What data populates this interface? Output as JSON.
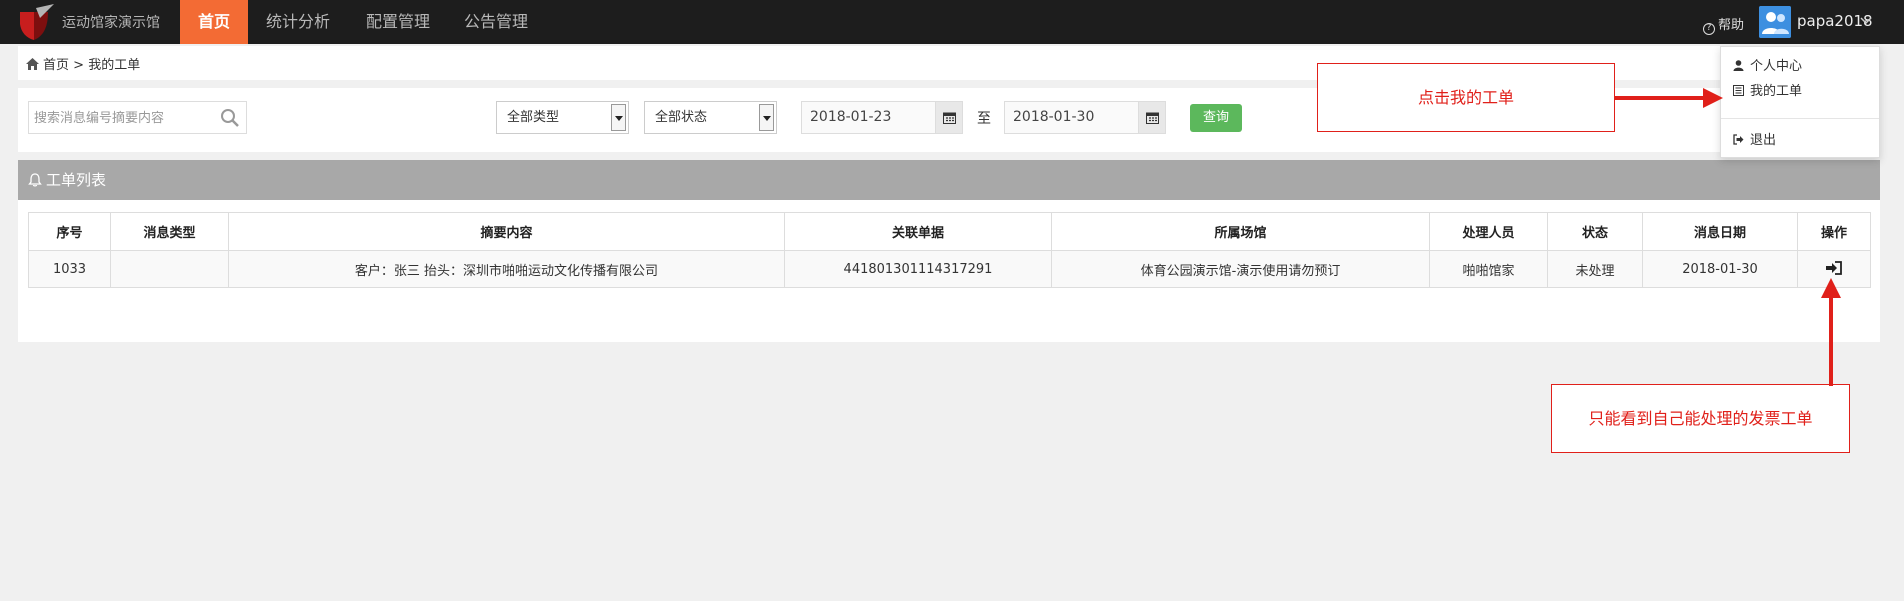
{
  "app": {
    "title": "运动馆家演示馆"
  },
  "nav": {
    "items": [
      {
        "label": "首页",
        "active": true
      },
      {
        "label": "统计分析",
        "active": false
      },
      {
        "label": "配置管理",
        "active": false
      },
      {
        "label": "公告管理",
        "active": false
      }
    ],
    "help_label": "帮助",
    "username": "papa2018"
  },
  "breadcrumb": {
    "home": "首页",
    "separator": ">",
    "current": "我的工单"
  },
  "filters": {
    "search_placeholder": "搜索消息编号摘要内容",
    "type_select": "全部类型",
    "status_select": "全部状态",
    "date_from": "2018-01-23",
    "date_to": "2018-01-30",
    "to_label": "至",
    "query_button": "查询"
  },
  "panel": {
    "title": "工单列表"
  },
  "table": {
    "columns": [
      "序号",
      "消息类型",
      "摘要内容",
      "关联单据",
      "所属场馆",
      "处理人员",
      "状态",
      "消息日期",
      "操作"
    ],
    "rows": [
      {
        "id": "1033",
        "type": "",
        "summary": "客户：张三 抬头：深圳市啪啪运动文化传播有限公司",
        "related": "441801301114317291",
        "venue": "体育公园演示馆-演示使用请勿预订",
        "handler": "啪啪馆家",
        "status": "未处理",
        "date": "2018-01-30"
      }
    ]
  },
  "user_menu": {
    "items": [
      "个人中心",
      "我的工单",
      "退出"
    ]
  },
  "annotations": {
    "top": "点击我的工单",
    "bottom": "只能看到自己能处理的发票工单"
  },
  "colors": {
    "nav_bg": "#1d1d1d",
    "nav_active": "#f36b34",
    "query_button": "#5cb85c",
    "panel_header": "#a8a8a8",
    "annotation_red": "#e0201a"
  }
}
